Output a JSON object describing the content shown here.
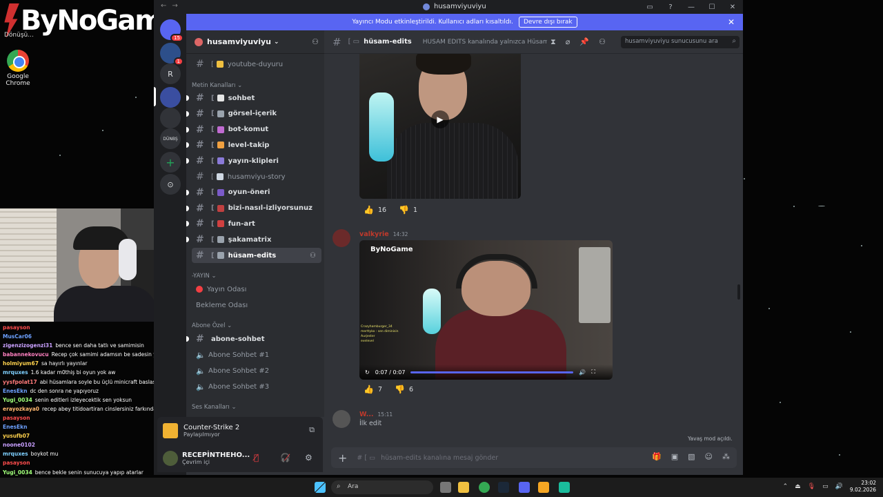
{
  "desktop": {
    "brand_logo": "ByNoGame",
    "top_label": "Dönüşü...",
    "chrome_label": "Google Chrome"
  },
  "stream_chat": [
    {
      "user": "pasayson",
      "text": "",
      "color": "#ff4d4d"
    },
    {
      "user": "MusCar06",
      "text": "",
      "color": "#6da0ff"
    },
    {
      "user": "zigenzizogenzi31",
      "text": "bence sen daha tatlı ve samimisin",
      "color": "#c9a0ff"
    },
    {
      "user": "babannekovucu",
      "text": "Recep çok samimi adamsın be sadesin ya",
      "color": "#ff80c0"
    },
    {
      "user": "holmiyum67",
      "text": "sa hayırlı yayınlar",
      "color": "#ffd24d"
    },
    {
      "user": "mrquxes",
      "text": "1.6 kadar m0thiş bi oyun yok aw",
      "color": "#7fd0ff"
    },
    {
      "user": "yysfpolat17",
      "text": "abi hüsamlara soyle bu üçlü minicraft baslasin sarar",
      "color": "#ff7a7a"
    },
    {
      "user": "EnesEkn",
      "text": "dc den sonra ne yapıyoruz",
      "color": "#6da0ff"
    },
    {
      "user": "Yugi_0034",
      "text": "senin editleri izleyecektik sen yoksun",
      "color": "#a0ff7a"
    },
    {
      "user": "erayozkaya0",
      "text": "recep abey titidoartiran cinslersiniz farkında mısınız",
      "color": "#ffb870"
    },
    {
      "user": "pasayson",
      "text": "",
      "color": "#ff4d4d"
    },
    {
      "user": "EnesEkn",
      "text": "",
      "color": "#6da0ff"
    },
    {
      "user": "yusufb07",
      "text": "",
      "color": "#ffd24d"
    },
    {
      "user": "noone0102",
      "text": "",
      "color": "#c9a0ff"
    },
    {
      "user": "mrquxes",
      "text": "boykot mu",
      "color": "#7fd0ff"
    },
    {
      "user": "pasayson",
      "text": "",
      "color": "#ff4d4d"
    },
    {
      "user": "Yugi_0034",
      "text": "bence bekle senin sunucuya yapıp atarlar",
      "color": "#a0ff7a"
    },
    {
      "user": "holmiyum67",
      "text": "",
      "color": "#ffd24d"
    }
  ],
  "window": {
    "title": "husamviyuviyu",
    "controls": [
      "▭",
      "?",
      "—",
      "☐",
      "✕"
    ]
  },
  "banner": {
    "text": "Yayıncı Modu etkinleştirildi. Kullanıcı adları kısaltıldı.",
    "button": "Devre dışı bırak",
    "close": "✕"
  },
  "guilds": [
    {
      "label": "",
      "badge": "15",
      "color": "#5865f2"
    },
    {
      "label": "",
      "badge": "1",
      "color": "#2d4f8a"
    },
    {
      "label": "R",
      "badge": "",
      "color": "#313338"
    },
    {
      "label": "",
      "badge": "",
      "color": "#3a4ea0"
    },
    {
      "label": "",
      "badge": "",
      "color": "#313338"
    },
    {
      "label": "DÜNBŞ",
      "badge": "",
      "color": "#313338"
    },
    {
      "label": "+",
      "badge": "",
      "color": "#313338"
    },
    {
      "label": "⊙",
      "badge": "",
      "color": "#313338"
    }
  ],
  "server": {
    "name": "husamviyuviyu"
  },
  "channels": {
    "youtube": "youtube-duyuru",
    "cat_text": "Metin Kanalları",
    "items": [
      {
        "name": "sohbet",
        "color": "#e6e6e6"
      },
      {
        "name": "görsel-içerik",
        "color": "#9aa3ad"
      },
      {
        "name": "bot-komut",
        "color": "#c06bd1"
      },
      {
        "name": "level-takip",
        "color": "#f0a040"
      },
      {
        "name": "yayın-klipleri",
        "color": "#8a7ad8"
      },
      {
        "name": "husamviyu-story",
        "color": "#cfd8e3"
      },
      {
        "name": "oyun-öneri",
        "color": "#7a5ac8"
      },
      {
        "name": "bizi-nasıl-izliyorsunuz",
        "color": "#c04040"
      },
      {
        "name": "fun-art",
        "color": "#d04040"
      },
      {
        "name": "şakamatrix",
        "color": "#9aa3ad"
      },
      {
        "name": "hüsam-edits",
        "color": "#9aa3ad"
      }
    ],
    "cat_yayin": "-YAYIN",
    "voice1": "Yayın Odası",
    "voice2": "Bekleme Odası",
    "cat_abone": "Abone Özel",
    "abone_text": "abone-sohbet",
    "abone_voice": [
      "Abone Sohbet #1",
      "Abone Sohbet #2",
      "Abone Sohbet #3"
    ],
    "cat_ses": "Ses Kanalları"
  },
  "activity": {
    "game": "Counter-Strike 2",
    "status": "Paylaşılmıyor"
  },
  "user": {
    "name": "RECEPİNTHEHO...",
    "status": "Çevrim içi"
  },
  "chan_header": {
    "name": "hüsam-edits",
    "topic": "HÜSAM EDİTS kanalında yalnızca Hüsam'a...",
    "search_placeholder": "husamviyuviyu sunucusunu ara"
  },
  "messages": [
    {
      "reactions": [
        {
          "emoji": "👍",
          "count": "16"
        },
        {
          "emoji": "👎",
          "count": "1"
        }
      ]
    },
    {
      "author": "valkyrie",
      "time": "14:32",
      "author_color": "#c0392b",
      "video": {
        "brand": "ByNoGame",
        "time": "0:07 / 0:07",
        "progress": 1.0,
        "overlay": [
          "Crazyhamburger_34",
          "merttyko : sen diminisin",
          "Aurjester",
          "evelevel"
        ]
      },
      "reactions": [
        {
          "emoji": "👍",
          "count": "7"
        },
        {
          "emoji": "👎",
          "count": "6"
        }
      ]
    },
    {
      "author": "W...",
      "time": "15:11",
      "author_color": "#c0392b",
      "text": "İlk edit"
    }
  ],
  "slowmode": "Yavaş mod açıldı.",
  "composer": {
    "placeholder": "hüsam-edits kanalına mesaj gönder"
  },
  "taskbar": {
    "search": "Ara",
    "time": "23:02",
    "date": "9.02.2026"
  }
}
